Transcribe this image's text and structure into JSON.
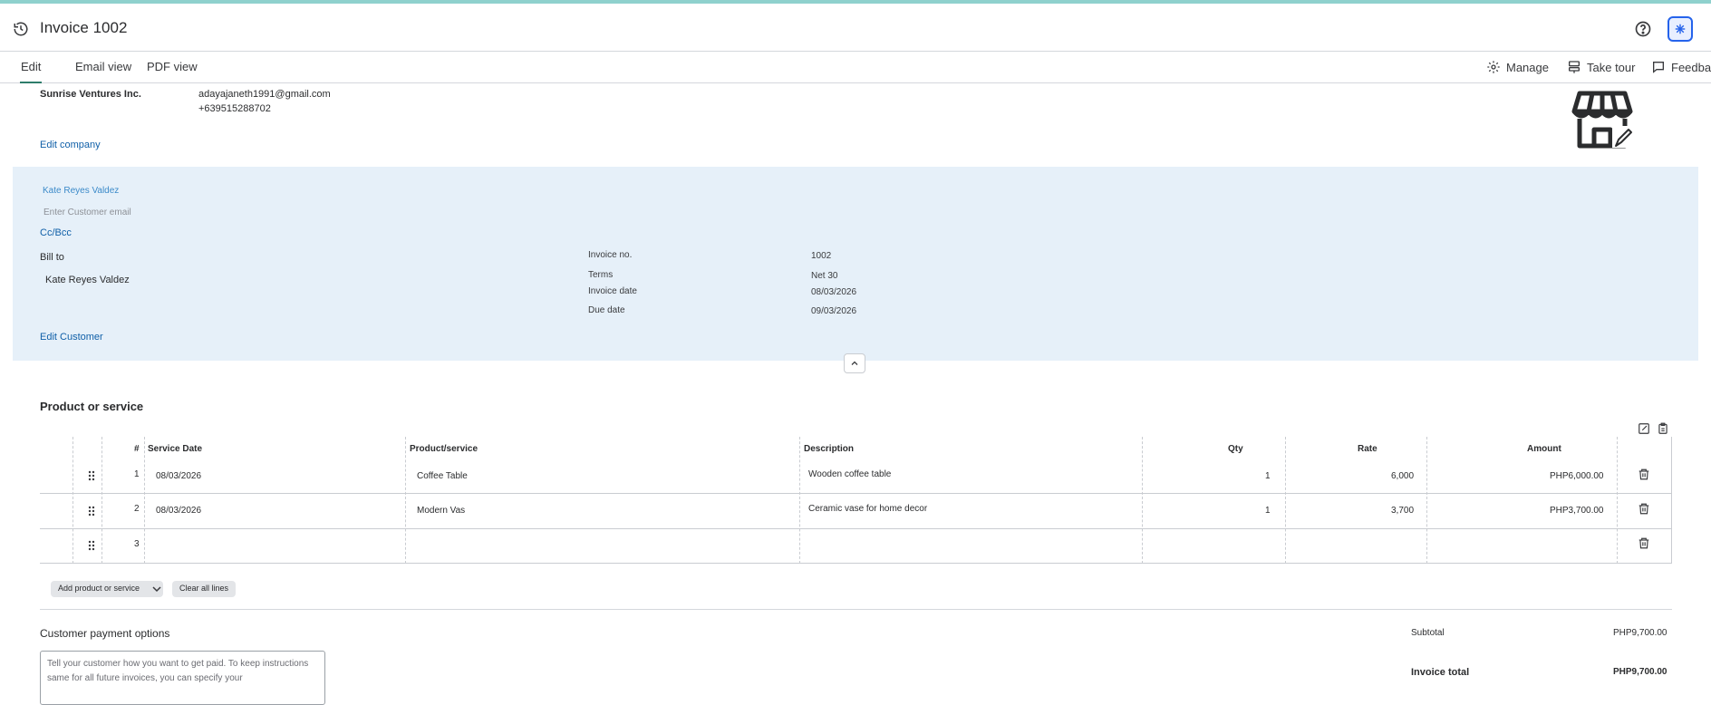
{
  "header": {
    "title": "Invoice 1002",
    "history_icon": "history-icon",
    "help_icon": "help-circle-icon",
    "bug_icon": "bug-icon"
  },
  "tabs": {
    "items": [
      {
        "label": "Edit"
      },
      {
        "label": "Email view"
      },
      {
        "label": "PDF view"
      }
    ],
    "actions": [
      {
        "label": "Manage",
        "icon": "gear-icon"
      },
      {
        "label": "Take tour",
        "icon": "tour-icon"
      },
      {
        "label": "Feedbac",
        "icon": "feedback-icon"
      }
    ]
  },
  "company": {
    "name": "Sunrise Ventures Inc.",
    "email": "adayajaneth1991@gmail.com",
    "phone": "+639515288702",
    "edit_label": "Edit company",
    "logo_icon": "storefront-icon",
    "edit_logo_icon": "pencil-icon"
  },
  "customer": {
    "name": "Kate Reyes Valdez",
    "email_placeholder": "Enter Customer email",
    "ccbcc_label": "Cc/Bcc",
    "bill_to_label": "Bill to",
    "bill_to_name": "Kate Reyes Valdez",
    "edit_label": "Edit Customer"
  },
  "invoice_meta": {
    "invoice_no_label": "Invoice no.",
    "invoice_no": "1002",
    "terms_label": "Terms",
    "terms": "Net 30",
    "invoice_date_label": "Invoice date",
    "invoice_date": "08/03/2026",
    "due_date_label": "Due date",
    "due_date": "09/03/2026"
  },
  "products": {
    "section_title": "Product or service",
    "columns": {
      "num": "#",
      "service_date": "Service Date",
      "product": "Product/service",
      "description": "Description",
      "qty": "Qty",
      "rate": "Rate",
      "amount": "Amount"
    },
    "rows": [
      {
        "num": "1",
        "service_date": "08/03/2026",
        "product": "Coffee Table",
        "description": "Wooden coffee table",
        "qty": "1",
        "rate": "6,000",
        "amount": "PHP6,000.00"
      },
      {
        "num": "2",
        "service_date": "08/03/2026",
        "product": "Modern Vas",
        "description": "Ceramic vase for home decor",
        "qty": "1",
        "rate": "3,700",
        "amount": "PHP3,700.00"
      },
      {
        "num": "3",
        "service_date": "",
        "product": "",
        "description": "",
        "qty": "",
        "rate": "",
        "amount": ""
      }
    ],
    "add_label": "Add product or service",
    "clear_label": "Clear all lines"
  },
  "payment": {
    "title": "Customer payment options",
    "placeholder": "Tell your customer how you want to get paid. To keep instructions same for all future invoices, you can specify your"
  },
  "totals": {
    "subtotal_label": "Subtotal",
    "subtotal": "PHP9,700.00",
    "total_label": "Invoice total",
    "total": "PHP9,700.00"
  },
  "colors": {
    "accent": "#2e7d6b",
    "link": "#0f5fa8",
    "customer_bg": "#e6f0f9"
  }
}
